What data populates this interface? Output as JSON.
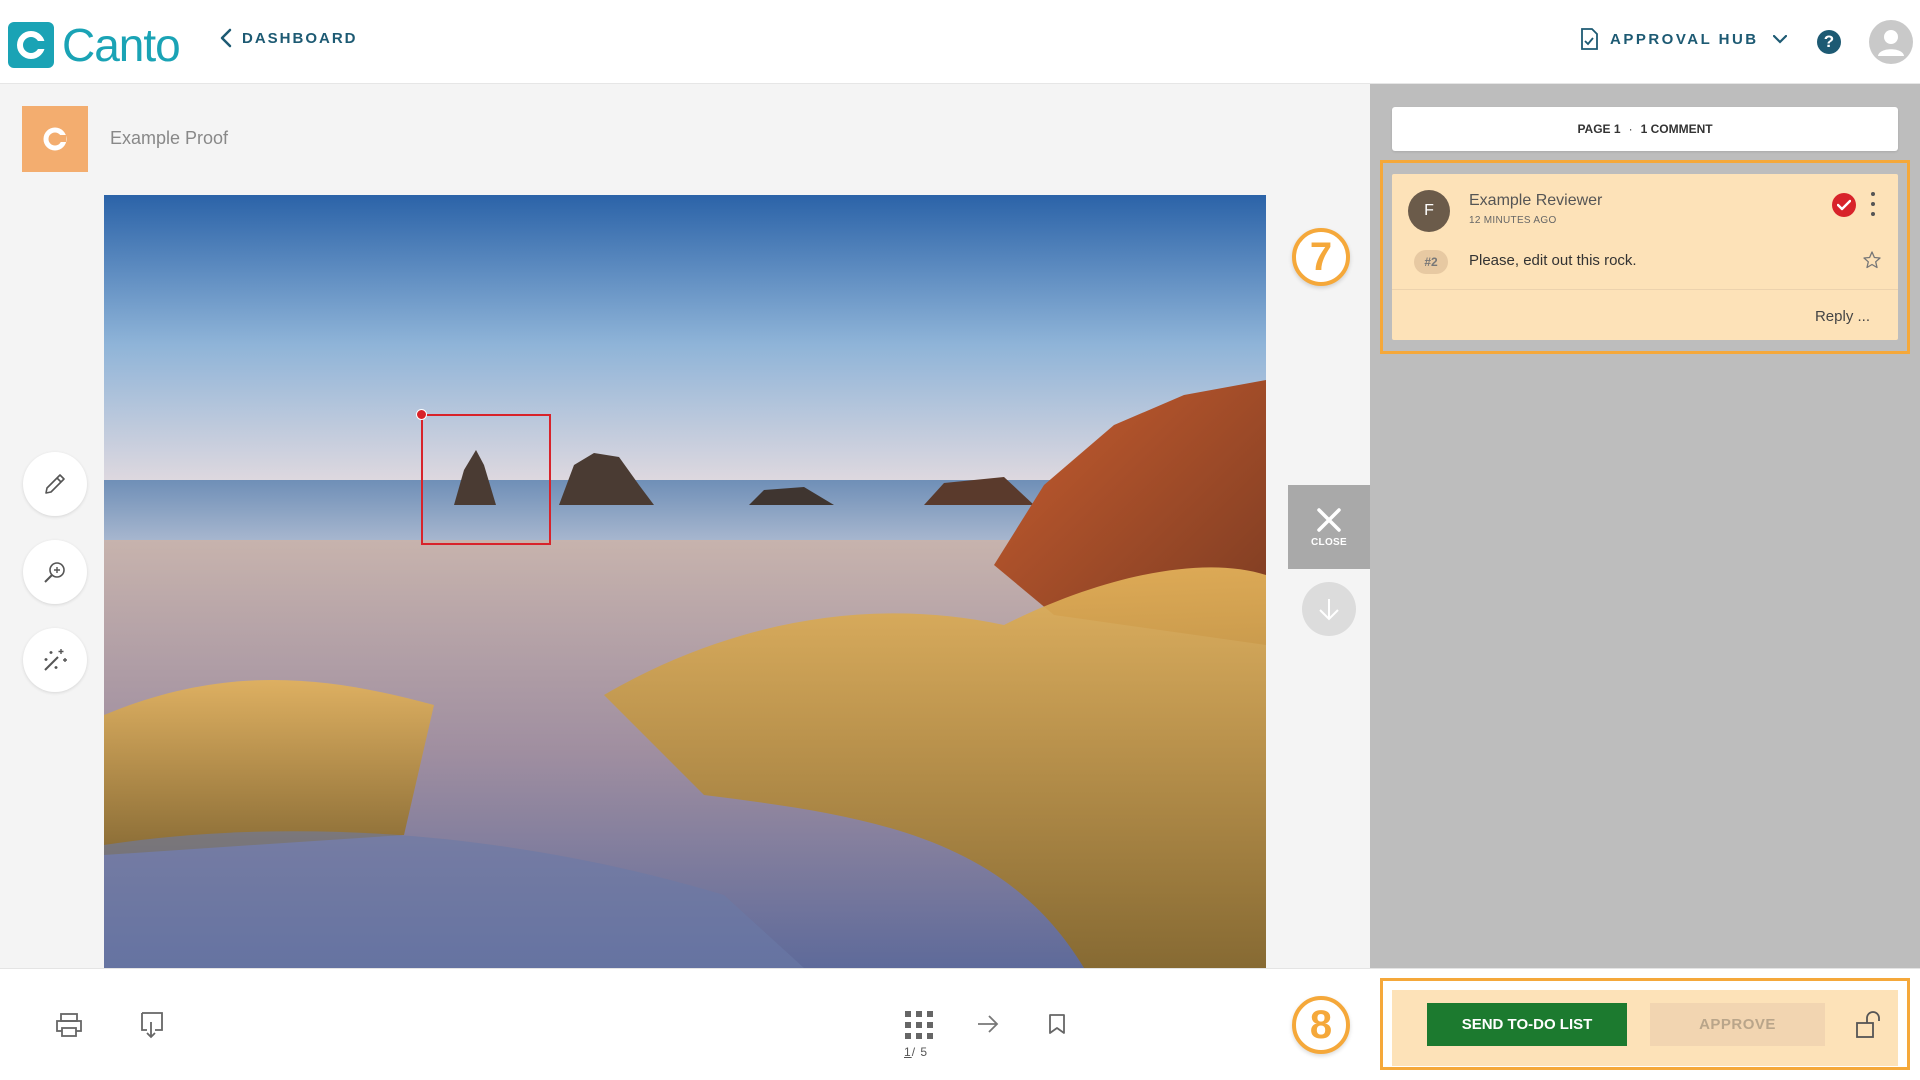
{
  "header": {
    "logo_text": "Canto",
    "back_label": "DASHBOARD",
    "hub_label": "APPROVAL HUB",
    "help_label": "?"
  },
  "proof": {
    "title": "Example Proof"
  },
  "viewer": {
    "close_label": "CLOSE"
  },
  "comments_panel": {
    "page_label": "PAGE 1",
    "separator": "·",
    "comment_count": "1 COMMENT",
    "comments": [
      {
        "avatar_initial": "F",
        "author": "Example Reviewer",
        "time": "12 MINUTES AGO",
        "number": "#2",
        "text": "Please, edit out this rock.",
        "reply_label": "Reply ..."
      }
    ]
  },
  "callouts": {
    "comment_badge": "7",
    "actions_badge": "8"
  },
  "footer": {
    "pager_current": "1",
    "pager_total": "/ 5",
    "send_todo_label": "SEND TO-DO LIST",
    "approve_label": "APPROVE"
  },
  "colors": {
    "brand": "#1aa3b5",
    "nav": "#1d5a73",
    "highlight": "#f5a83a",
    "send_button": "#1c7a2f",
    "annotation": "#d8232a"
  }
}
